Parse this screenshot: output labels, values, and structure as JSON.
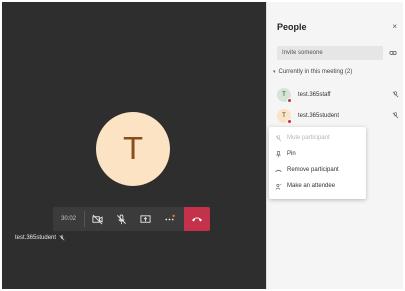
{
  "call": {
    "avatar_initial": "T",
    "timer": "30:02",
    "participant_name": "test.365student"
  },
  "panel": {
    "title": "People",
    "close_glyph": "×",
    "invite_placeholder": "Invite someone",
    "section_label": "Currently in this meeting (2)",
    "participants": [
      {
        "initial": "T",
        "name": "test.365staff",
        "avatar_color": "#d6e4d6"
      },
      {
        "initial": "T",
        "name": "test.365student",
        "avatar_color": "#fbe3c4"
      }
    ],
    "menu": [
      {
        "label": "Mute participant",
        "icon": "mic-off-icon",
        "disabled": true
      },
      {
        "label": "Pin",
        "icon": "pin-icon",
        "disabled": false
      },
      {
        "label": "Remove participant",
        "icon": "remove-person-icon",
        "disabled": false
      },
      {
        "label": "Make an attendee",
        "icon": "attendee-icon",
        "disabled": false
      }
    ]
  },
  "colors": {
    "stage_bg": "#2e2e2e",
    "hangup": "#c4314b",
    "avatar_bg": "#fbe3c4",
    "avatar_fg": "#8a4d1e"
  }
}
